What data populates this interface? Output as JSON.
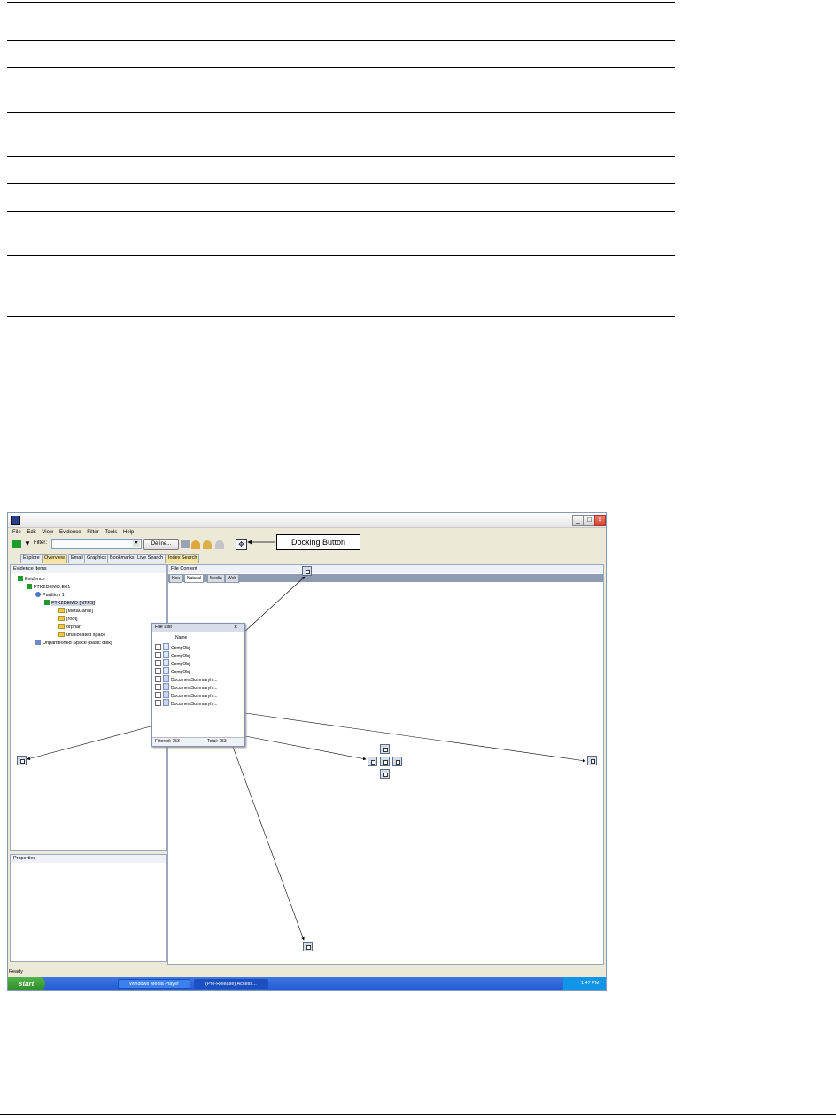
{
  "app": {
    "menu": [
      "File",
      "Edit",
      "View",
      "Evidence",
      "Filter",
      "Tools",
      "Help"
    ],
    "filter_label": "Filter:",
    "define_label": "Define...",
    "callout_label": "Docking Button",
    "tabs": [
      "Explore",
      "Overview",
      "Email",
      "Graphics",
      "Bookmarks",
      "Live Search",
      "Index Search"
    ],
    "evidence_panel": {
      "title": "Evidence Items",
      "tree": [
        "Evidence",
        "FTK2DEMO.E01",
        "Partition 1",
        "FTK2DEMO [NTFS]",
        "[MetaCarve]",
        "[root]",
        "orphan",
        "unallocated space",
        "Unpartitioned Space [basic disk]"
      ]
    },
    "properties_title": "Properties",
    "file_content": {
      "title": "File Content",
      "tabs": [
        "Hex",
        "Natural",
        "Media",
        "Web"
      ]
    },
    "file_list": {
      "title": "File List",
      "column": "Name",
      "rows": [
        "CompObj",
        "CompObj",
        "CompObj",
        "CompObj",
        "DocumentSummaryIn...",
        "DocumentSummaryIn...",
        "DocumentSummaryIn...",
        "DocumentSummaryIn..."
      ],
      "filtered": "Filtered: 753",
      "total": "Total: 753"
    },
    "status": "Ready"
  },
  "taskbar": {
    "start": "start",
    "items": [
      "Windows Media Player",
      "(Pre-Release) Access..."
    ],
    "clock": "1:47 PM"
  }
}
